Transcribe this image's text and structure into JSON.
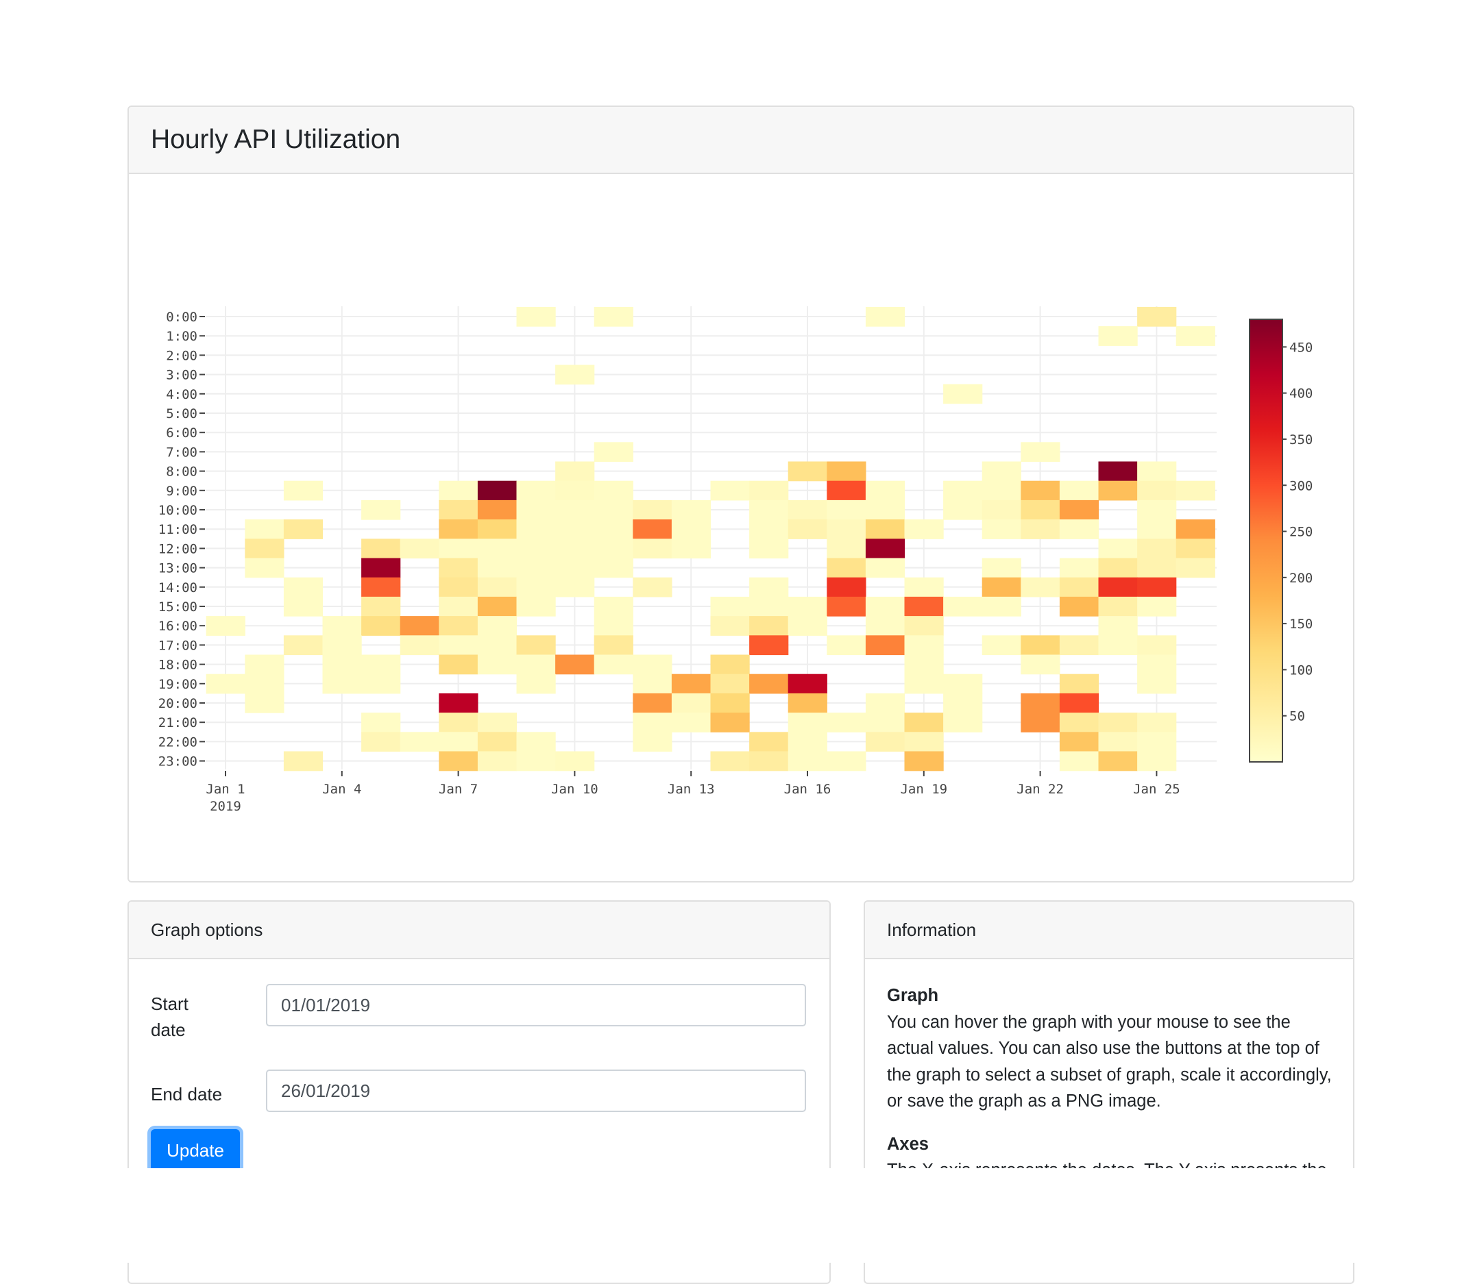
{
  "main": {
    "title": "Hourly API Utilization"
  },
  "chart_data": {
    "type": "heatmap",
    "x": [
      "2019-01-01",
      "2019-01-02",
      "2019-01-03",
      "2019-01-04",
      "2019-01-05",
      "2019-01-06",
      "2019-01-07",
      "2019-01-08",
      "2019-01-09",
      "2019-01-10",
      "2019-01-11",
      "2019-01-12",
      "2019-01-13",
      "2019-01-14",
      "2019-01-15",
      "2019-01-16",
      "2019-01-17",
      "2019-01-18",
      "2019-01-19",
      "2019-01-20",
      "2019-01-21",
      "2019-01-22",
      "2019-01-23",
      "2019-01-24",
      "2019-01-25",
      "2019-01-26"
    ],
    "y": [
      "0:00",
      "1:00",
      "2:00",
      "3:00",
      "4:00",
      "5:00",
      "6:00",
      "7:00",
      "8:00",
      "9:00",
      "10:00",
      "11:00",
      "12:00",
      "13:00",
      "14:00",
      "15:00",
      "16:00",
      "17:00",
      "18:00",
      "19:00",
      "20:00",
      "21:00",
      "22:00",
      "23:00"
    ],
    "x_ticks": [
      {
        "x": 0,
        "label": "Jan 1",
        "sublabel": "2019"
      },
      {
        "x": 3,
        "label": "Jan 4"
      },
      {
        "x": 6,
        "label": "Jan 7"
      },
      {
        "x": 9,
        "label": "Jan 10"
      },
      {
        "x": 12,
        "label": "Jan 13"
      },
      {
        "x": 15,
        "label": "Jan 16"
      },
      {
        "x": 18,
        "label": "Jan 19"
      },
      {
        "x": 21,
        "label": "Jan 22"
      },
      {
        "x": 24,
        "label": "Jan 25"
      }
    ],
    "z": [
      [
        null,
        null,
        null,
        null,
        null,
        null,
        null,
        null,
        10,
        null,
        10,
        null,
        null,
        null,
        null,
        null,
        null,
        10,
        null,
        null,
        null,
        null,
        null,
        null,
        60,
        null
      ],
      [
        null,
        null,
        null,
        null,
        null,
        null,
        null,
        null,
        null,
        null,
        null,
        null,
        null,
        null,
        null,
        null,
        null,
        null,
        null,
        null,
        null,
        null,
        null,
        10,
        null,
        10
      ],
      [
        null,
        null,
        null,
        null,
        null,
        null,
        null,
        null,
        null,
        null,
        null,
        null,
        null,
        null,
        null,
        null,
        null,
        null,
        null,
        null,
        null,
        null,
        null,
        null,
        null,
        null
      ],
      [
        null,
        null,
        null,
        null,
        null,
        null,
        null,
        null,
        null,
        10,
        null,
        null,
        null,
        null,
        null,
        null,
        null,
        null,
        null,
        null,
        null,
        null,
        null,
        null,
        null,
        null
      ],
      [
        null,
        null,
        null,
        null,
        null,
        null,
        null,
        null,
        null,
        null,
        null,
        null,
        null,
        null,
        null,
        null,
        null,
        null,
        null,
        10,
        null,
        null,
        null,
        null,
        null,
        null
      ],
      [
        null,
        null,
        null,
        null,
        null,
        null,
        null,
        null,
        null,
        null,
        null,
        null,
        null,
        null,
        null,
        null,
        null,
        null,
        null,
        null,
        null,
        null,
        null,
        null,
        null,
        null
      ],
      [
        null,
        null,
        null,
        null,
        null,
        null,
        null,
        null,
        null,
        null,
        null,
        null,
        null,
        null,
        null,
        null,
        null,
        null,
        null,
        null,
        null,
        null,
        null,
        null,
        null,
        null
      ],
      [
        null,
        null,
        null,
        null,
        null,
        null,
        null,
        null,
        null,
        null,
        10,
        null,
        null,
        null,
        null,
        null,
        null,
        null,
        null,
        null,
        null,
        10,
        null,
        null,
        null,
        null
      ],
      [
        null,
        null,
        null,
        null,
        null,
        null,
        null,
        null,
        null,
        20,
        null,
        null,
        null,
        null,
        null,
        90,
        160,
        null,
        null,
        null,
        10,
        null,
        null,
        470,
        10,
        null
      ],
      [
        null,
        null,
        10,
        null,
        null,
        null,
        10,
        480,
        10,
        15,
        10,
        null,
        null,
        10,
        20,
        null,
        300,
        10,
        null,
        10,
        10,
        160,
        10,
        160,
        30,
        20
      ],
      [
        null,
        null,
        null,
        null,
        10,
        null,
        80,
        220,
        10,
        10,
        10,
        30,
        10,
        null,
        10,
        20,
        10,
        10,
        null,
        10,
        20,
        90,
        210,
        null,
        10,
        null
      ],
      [
        null,
        10,
        70,
        null,
        null,
        null,
        150,
        120,
        10,
        10,
        10,
        260,
        10,
        null,
        10,
        40,
        20,
        120,
        10,
        null,
        10,
        40,
        10,
        null,
        10,
        200
      ],
      [
        null,
        70,
        null,
        null,
        80,
        20,
        10,
        10,
        10,
        10,
        10,
        20,
        10,
        null,
        10,
        null,
        20,
        450,
        null,
        null,
        null,
        null,
        null,
        10,
        40,
        80
      ],
      [
        null,
        10,
        null,
        null,
        450,
        null,
        70,
        10,
        10,
        10,
        10,
        null,
        null,
        null,
        null,
        null,
        90,
        10,
        null,
        null,
        10,
        null,
        10,
        70,
        40,
        30
      ],
      [
        null,
        null,
        10,
        null,
        280,
        null,
        80,
        30,
        10,
        10,
        null,
        30,
        null,
        null,
        10,
        null,
        330,
        null,
        10,
        null,
        170,
        20,
        70,
        330,
        320,
        null
      ],
      [
        null,
        null,
        10,
        null,
        60,
        null,
        20,
        170,
        10,
        null,
        10,
        null,
        null,
        10,
        10,
        10,
        280,
        10,
        280,
        10,
        10,
        null,
        170,
        50,
        10,
        null
      ],
      [
        10,
        null,
        null,
        10,
        100,
        220,
        80,
        10,
        null,
        null,
        10,
        null,
        null,
        30,
        80,
        10,
        null,
        10,
        40,
        null,
        null,
        null,
        null,
        10,
        null,
        null
      ],
      [
        null,
        null,
        40,
        10,
        null,
        20,
        10,
        10,
        80,
        null,
        70,
        null,
        null,
        null,
        290,
        null,
        10,
        250,
        10,
        null,
        10,
        120,
        40,
        10,
        20,
        null
      ],
      [
        null,
        10,
        null,
        10,
        10,
        null,
        110,
        10,
        10,
        230,
        10,
        10,
        null,
        100,
        null,
        null,
        null,
        null,
        10,
        null,
        null,
        10,
        null,
        null,
        10,
        null
      ],
      [
        10,
        10,
        null,
        10,
        10,
        null,
        null,
        null,
        10,
        null,
        null,
        10,
        200,
        70,
        210,
        410,
        null,
        null,
        10,
        10,
        null,
        null,
        90,
        null,
        10,
        null
      ],
      [
        null,
        10,
        null,
        null,
        null,
        null,
        420,
        null,
        null,
        null,
        null,
        220,
        20,
        120,
        null,
        160,
        null,
        10,
        null,
        10,
        null,
        230,
        300,
        null,
        null,
        null
      ],
      [
        null,
        null,
        null,
        null,
        10,
        null,
        50,
        20,
        null,
        null,
        null,
        10,
        10,
        160,
        null,
        10,
        10,
        10,
        110,
        10,
        null,
        230,
        70,
        50,
        20,
        null
      ],
      [
        null,
        null,
        null,
        null,
        30,
        10,
        10,
        70,
        10,
        null,
        null,
        10,
        null,
        null,
        90,
        10,
        null,
        40,
        30,
        null,
        null,
        null,
        150,
        20,
        10,
        null
      ],
      [
        null,
        null,
        40,
        null,
        null,
        null,
        140,
        20,
        10,
        15,
        null,
        null,
        null,
        50,
        60,
        10,
        10,
        null,
        160,
        null,
        null,
        null,
        10,
        140,
        10,
        null
      ]
    ],
    "colorscale": "YlOrRd",
    "zlim": [
      0,
      480
    ],
    "colorbar_ticks": [
      50,
      100,
      150,
      200,
      250,
      300,
      350,
      400,
      450
    ]
  },
  "options": {
    "title": "Graph options",
    "start_label_1": "Start",
    "start_label_2": "date",
    "start_value": "01/01/2019",
    "end_label": "End date",
    "end_value": "26/01/2019",
    "update_label": "Update"
  },
  "info": {
    "title": "Information",
    "graph_heading": "Graph",
    "graph_text": "You can hover the graph with your mouse to see the actual values. You can also use the buttons at the top of the graph to select a subset of graph, scale it accordingly, or save the graph as a PNG image.",
    "axes_heading": "Axes",
    "axes_text": "The X-axis represents the dates. The Y-axis presents the hours of the day."
  }
}
